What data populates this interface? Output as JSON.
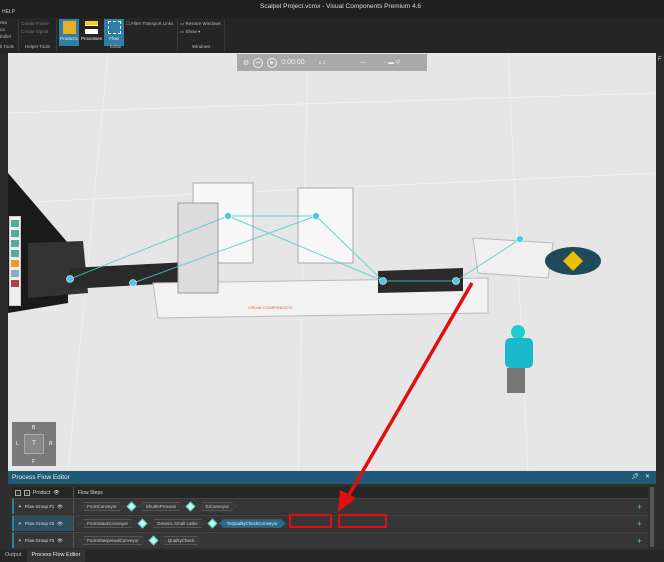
{
  "window": {
    "title": "Scalpel Project.vcmx - Visual Components Premium 4.6"
  },
  "menu": {
    "help": "HELP"
  },
  "ribbon": {
    "left_items": [
      "nks",
      "ca",
      "troller",
      "k Tools"
    ],
    "helper_tools": {
      "create_frame": "Create Frame",
      "create_signal": "Create Signal",
      "group": "Helper Tools"
    },
    "editor": {
      "products": "Products",
      "processes": "Processes",
      "flow": "Flow",
      "filter": "Filter Transport Links",
      "group": "Editor"
    },
    "windows": {
      "restore": "Restore Windows",
      "show": "Show ▾",
      "group": "Windows"
    }
  },
  "simbar": {
    "time": "0:00:00",
    "speed": "x 1"
  },
  "rightstrip": {
    "label": "F"
  },
  "navcube": {
    "top": "T",
    "back": "B",
    "left": "L",
    "right": "R",
    "front": "F"
  },
  "scene": {
    "logo": "VISUAL COMPONENTS"
  },
  "pfe": {
    "title": "Process Flow Editor",
    "col_product": "Product",
    "col_steps": "Flow Steps",
    "rows": [
      {
        "name": "Flow Group #1",
        "steps": [
          "FromConveyor",
          "ShuttleProcess",
          "ToConveyor"
        ]
      },
      {
        "name": "Flow Group #2",
        "steps": [
          "FromStackConveyor",
          "Generic Small Lathe",
          "ToQualityCheckConveyor"
        ]
      },
      {
        "name": "Flow Group #3",
        "steps": [
          "FromSharpenedConveyor",
          "QualityCheck"
        ]
      }
    ]
  },
  "tabs": [
    "Output",
    "Process Flow Editor"
  ],
  "colors": {
    "accent": "#2e7fa3",
    "annotation": "#e01010",
    "add": "#55cc55"
  }
}
